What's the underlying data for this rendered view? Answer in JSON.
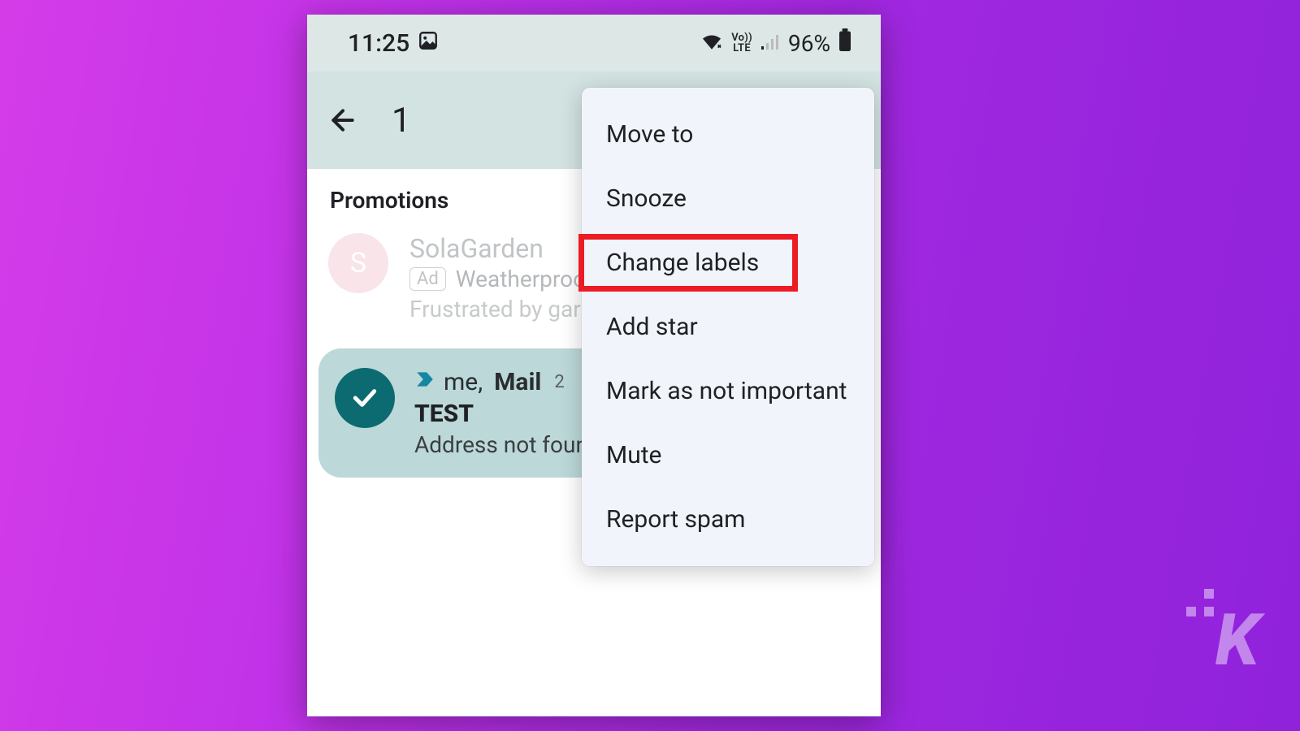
{
  "statusbar": {
    "time": "11:25",
    "battery_pct": "96%",
    "volte": "Vo))\nLTE"
  },
  "appbar": {
    "selection_count": "1"
  },
  "section": {
    "label": "Promotions"
  },
  "promo": {
    "avatar_letter": "S",
    "sender": "SolaGarden",
    "ad_badge": "Ad",
    "subject": "Weatherproo",
    "snippet": "Frustrated by gar"
  },
  "email": {
    "sender_me": "me,",
    "sender_mail": "Mail",
    "count": "2",
    "subject": "TEST",
    "snippet": "Address not foun"
  },
  "menu": {
    "items": [
      "Move to",
      "Snooze",
      "Change labels",
      "Add star",
      "Mark as not important",
      "Mute",
      "Report spam"
    ]
  },
  "watermark": "K"
}
